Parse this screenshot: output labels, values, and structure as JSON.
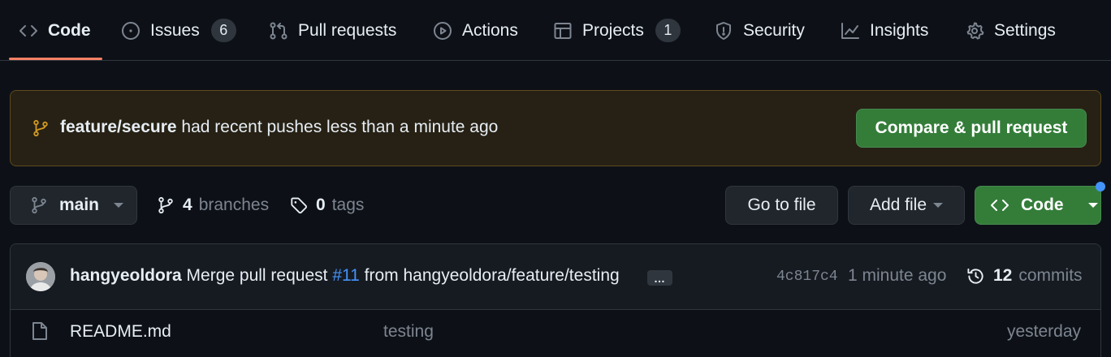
{
  "nav": {
    "tabs": [
      {
        "label": "Code",
        "icon": "code-icon",
        "active": true
      },
      {
        "label": "Issues",
        "icon": "issue-opened-icon",
        "count": "6"
      },
      {
        "label": "Pull requests",
        "icon": "git-pull-request-icon"
      },
      {
        "label": "Actions",
        "icon": "play-icon"
      },
      {
        "label": "Projects",
        "icon": "table-icon",
        "count": "1"
      },
      {
        "label": "Security",
        "icon": "shield-icon"
      },
      {
        "label": "Insights",
        "icon": "graph-icon"
      },
      {
        "label": "Settings",
        "icon": "gear-icon"
      }
    ],
    "accent_color": "#f78166"
  },
  "banner": {
    "branch": "feature/secure",
    "message": "had recent pushes less than a minute ago",
    "button": "Compare & pull request",
    "icon": "git-branch-icon"
  },
  "toolbar": {
    "branch": "main",
    "branches_count": "4",
    "branches_label": "branches",
    "tags_count": "0",
    "tags_label": "tags",
    "go_to_file": "Go to file",
    "add_file": "Add file",
    "code": "Code"
  },
  "commit": {
    "author": "hangyeoldora",
    "message_pre": "Merge pull request",
    "pr_ref": "#11",
    "message_post": "from hangyeoldora/feature/testing",
    "ellipsis": "…",
    "sha": "4c817c4",
    "time": "1 minute ago",
    "commits_count": "12",
    "commits_label": "commits"
  },
  "files": [
    {
      "name": "README.md",
      "message": "testing",
      "time": "yesterday",
      "icon": "file-icon"
    }
  ],
  "colors": {
    "background": "#0d1117",
    "primary_button": "#347d39",
    "link": "#4493f8",
    "banner_bg": "#272115"
  }
}
